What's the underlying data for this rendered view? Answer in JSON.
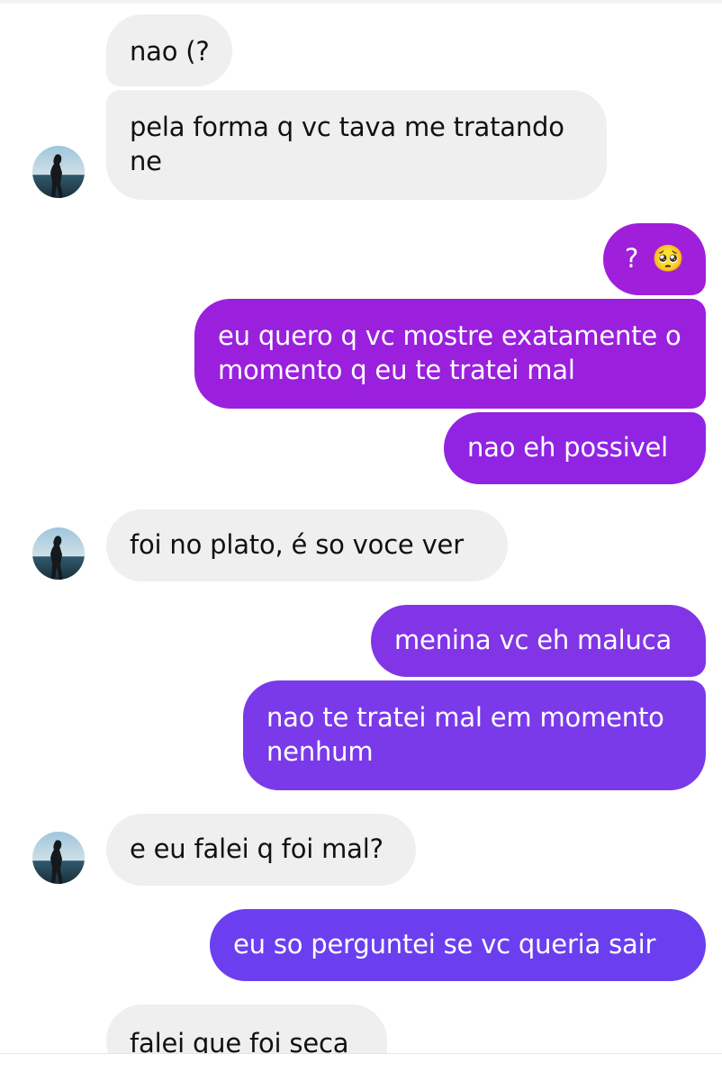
{
  "messages": [
    {
      "from": "them",
      "text": "nao (?"
    },
    {
      "from": "them",
      "text": "pela forma q vc tava me tratando ne"
    },
    {
      "from": "me",
      "text": "?",
      "emoji": "🥺"
    },
    {
      "from": "me",
      "text": "eu quero q vc mostre exatamente o momento q eu te tratei mal"
    },
    {
      "from": "me",
      "text": "nao eh possivel"
    },
    {
      "from": "them",
      "text": "foi no plato, é so voce ver"
    },
    {
      "from": "me",
      "text": "menina vc eh maluca"
    },
    {
      "from": "me",
      "text": "nao te tratei mal em momento nenhum"
    },
    {
      "from": "them",
      "text": "e eu falei q foi mal?"
    },
    {
      "from": "me",
      "text": "eu so perguntei se vc queria sair"
    },
    {
      "from": "them",
      "text": "falei que foi seca"
    }
  ],
  "colors": {
    "incoming_bubble": "#efefef",
    "outgoing_gradient_top": "#a21fd9",
    "outgoing_gradient_bottom": "#6a3cf0"
  }
}
